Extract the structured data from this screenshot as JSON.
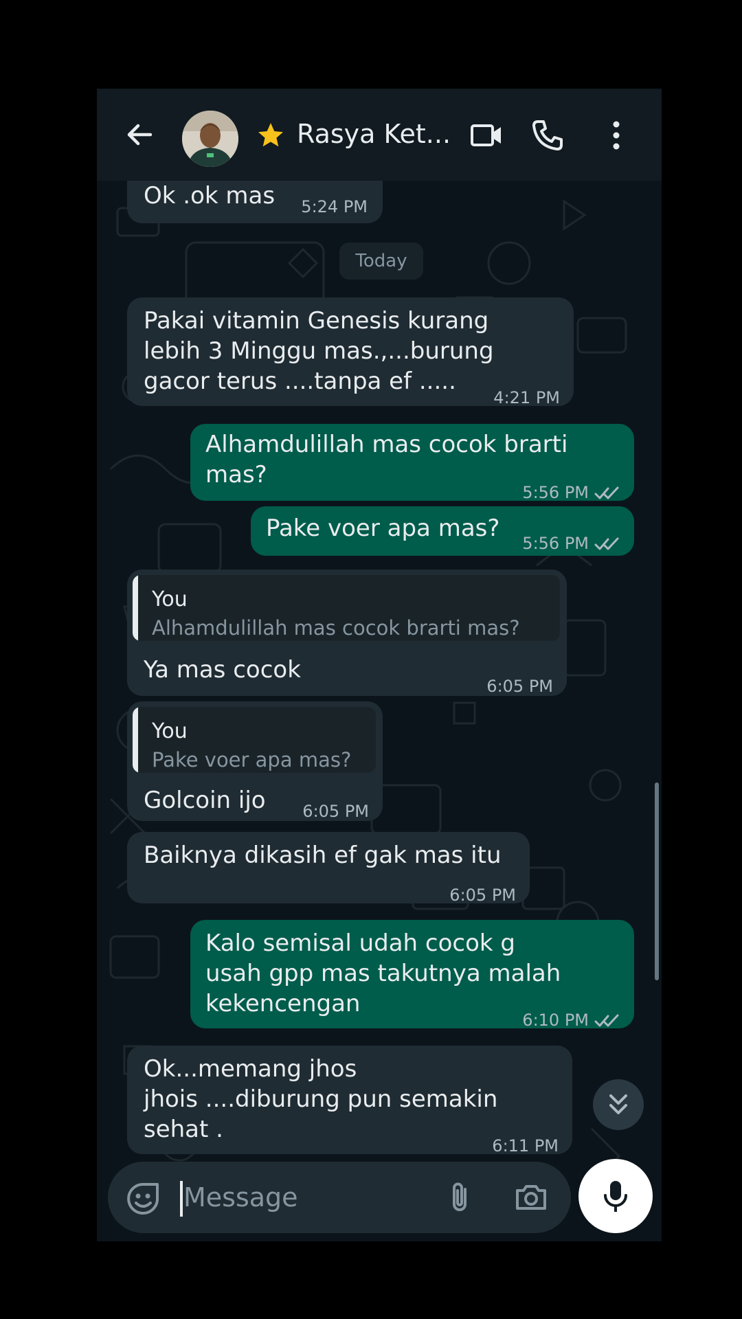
{
  "header": {
    "contact_name": "Rasya Ket...",
    "icons": [
      "back-arrow-icon",
      "avatar",
      "star-icon",
      "video-call-icon",
      "phone-icon",
      "more-vert-icon"
    ]
  },
  "date_chip": "Today",
  "messages": [
    {
      "dir": "in",
      "text": "Ok .ok mas",
      "time": "5:24 PM"
    },
    {
      "dir": "in",
      "text": "Pakai vitamin Genesis kurang\nlebih 3 Minggu mas.,...burung\ngacor terus ....tanpa ef .....",
      "time": "4:21 PM"
    },
    {
      "dir": "out",
      "text": "Alhamdulillah mas cocok brarti\nmas?",
      "time": "5:56 PM"
    },
    {
      "dir": "out",
      "text": "Pake voer apa mas?",
      "time": "5:56 PM"
    },
    {
      "dir": "in",
      "quote_author": "You",
      "quote_text": "Alhamdulillah mas cocok brarti mas?",
      "text": "Ya mas cocok",
      "time": "6:05 PM"
    },
    {
      "dir": "in",
      "quote_author": "You",
      "quote_text": "Pake voer apa mas?",
      "text": "Golcoin ijo",
      "time": "6:05 PM"
    },
    {
      "dir": "in",
      "text": "Baiknya dikasih ef gak mas itu",
      "time": "6:05 PM"
    },
    {
      "dir": "out",
      "text": "Kalo semisal udah cocok g\nusah gpp mas takutnya malah\nkekencengan",
      "time": "6:10 PM"
    },
    {
      "dir": "in",
      "text": "Ok...memang jhos\njhois ....diburung pun semakin\nsehat .",
      "time": "6:11 PM"
    }
  ],
  "composer": {
    "placeholder": "Message",
    "icons": [
      "sticker-icon",
      "attach-icon",
      "camera-icon",
      "mic-icon"
    ]
  },
  "colors": {
    "background": "#0b141a",
    "header": "#111b21",
    "incoming_bubble": "#202c33",
    "outgoing_bubble": "#005c4b",
    "text": "#e9edef",
    "meta_text": "#aebac1",
    "read_ticks": "#aebac1"
  }
}
